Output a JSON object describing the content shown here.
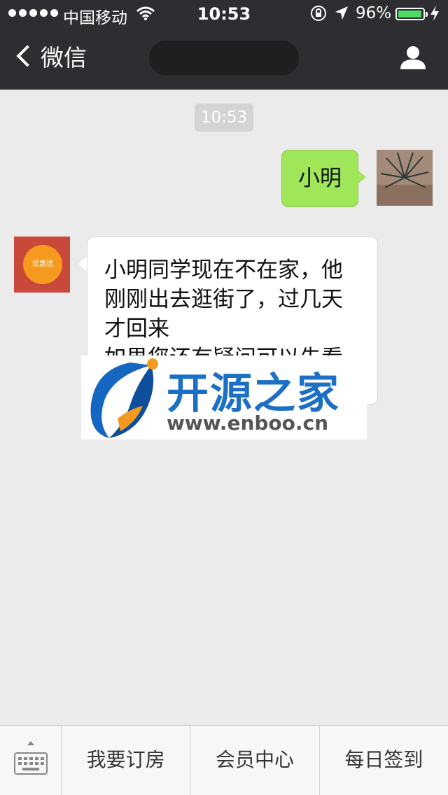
{
  "status_bar": {
    "carrier": "中国移动",
    "time": "10:53",
    "battery_percent": "96%",
    "battery_level": 0.96
  },
  "nav": {
    "back_label": "微信"
  },
  "chat": {
    "timestamp": "10:53",
    "messages": [
      {
        "from": "me",
        "text": "小明"
      },
      {
        "from": "bot",
        "text": "小明同学现在不在家，他\n刚刚出去逛街了，过几天\n才回来\n如果您还有疑问可以先看"
      }
    ],
    "bot_avatar_text": "优惠送"
  },
  "watermark": {
    "title": "开源之家",
    "url": "www.enboo.cn"
  },
  "menu": {
    "items": [
      "我要订房",
      "会员中心",
      "每日签到"
    ]
  },
  "colors": {
    "topbar": "#2e2e32",
    "chat_bg": "#ebebeb",
    "my_bubble": "#9fe658",
    "battery": "#4cd964"
  }
}
